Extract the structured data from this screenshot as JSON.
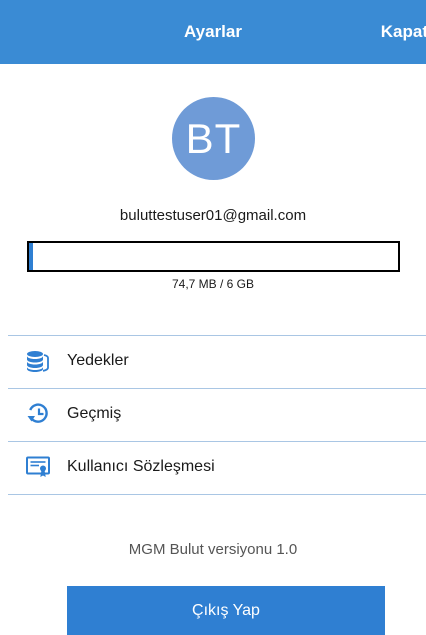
{
  "header": {
    "title": "Ayarlar",
    "close_label": "Kapat"
  },
  "profile": {
    "initials": "BT",
    "email": "buluttestuser01@gmail.com"
  },
  "storage": {
    "used_text": "74,7 MB / 6 GB",
    "used_fraction": 0.012
  },
  "menu": {
    "items": [
      {
        "label": "Yedekler",
        "icon": "database-icon"
      },
      {
        "label": "Geçmiş",
        "icon": "history-icon"
      },
      {
        "label": "Kullanıcı Sözleşmesi",
        "icon": "certificate-icon"
      }
    ]
  },
  "footer": {
    "version_text": "MGM Bulut versiyonu 1.0",
    "logout_label": "Çıkış Yap"
  },
  "colors": {
    "accent": "#3a8bd4",
    "button": "#2f7fd2",
    "avatar": "#6f9bd7",
    "divider": "#a9c6e4"
  }
}
